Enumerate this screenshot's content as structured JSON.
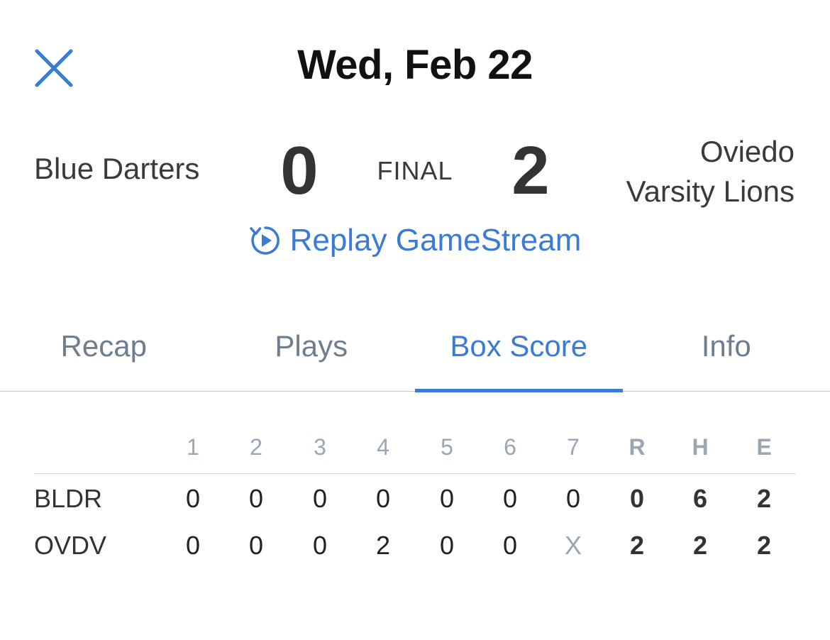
{
  "header": {
    "close_icon": "close-icon",
    "date": "Wed, Feb 22"
  },
  "game": {
    "away_team": "Blue Darters",
    "away_score": "0",
    "status": "FINAL",
    "home_score": "2",
    "home_team_line1": "Oviedo",
    "home_team_line2": "Varsity Lions"
  },
  "replay": {
    "icon": "replay-icon",
    "label": "Replay GameStream"
  },
  "tabs": [
    {
      "label": "Recap"
    },
    {
      "label": "Plays"
    },
    {
      "label": "Box Score",
      "active": true
    },
    {
      "label": "Info"
    }
  ],
  "box_score": {
    "headers": [
      "1",
      "2",
      "3",
      "4",
      "5",
      "6",
      "7",
      "R",
      "H",
      "E"
    ],
    "rows": [
      {
        "team": "BLDR",
        "cells": [
          "0",
          "0",
          "0",
          "0",
          "0",
          "0",
          "0",
          "0",
          "6",
          "2"
        ]
      },
      {
        "team": "OVDV",
        "cells": [
          "0",
          "0",
          "0",
          "2",
          "0",
          "0",
          "X",
          "2",
          "2",
          "2"
        ]
      }
    ]
  },
  "colors": {
    "accent": "#3a7bd5",
    "tab_inactive": "#6e7d8f",
    "header_muted": "#9aa6b2"
  }
}
